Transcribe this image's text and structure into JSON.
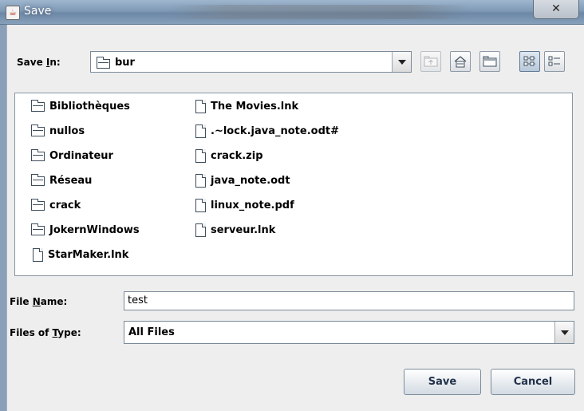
{
  "window": {
    "title": "Save",
    "close_label": "✕"
  },
  "save_in": {
    "label_pre": "Save ",
    "label_mnemonic": "I",
    "label_post": "n:",
    "value": "bur"
  },
  "toolbar": {
    "buttons": [
      "up-one-level",
      "home",
      "new-folder",
      "list-view",
      "details-view"
    ]
  },
  "files": {
    "left_column": [
      {
        "name": "Bibliothèques",
        "type": "folder"
      },
      {
        "name": "nullos",
        "type": "folder"
      },
      {
        "name": "Ordinateur",
        "type": "folder"
      },
      {
        "name": "Réseau",
        "type": "folder"
      },
      {
        "name": "crack",
        "type": "folder"
      },
      {
        "name": "JokernWindows",
        "type": "folder"
      },
      {
        "name": "StarMaker.lnk",
        "type": "file"
      }
    ],
    "right_column": [
      {
        "name": "The Movies.lnk",
        "type": "file"
      },
      {
        "name": ".~lock.java_note.odt#",
        "type": "file"
      },
      {
        "name": "crack.zip",
        "type": "file"
      },
      {
        "name": "java_note.odt",
        "type": "file"
      },
      {
        "name": "linux_note.pdf",
        "type": "file"
      },
      {
        "name": "serveur.lnk",
        "type": "file"
      }
    ]
  },
  "file_name": {
    "label_pre": "File ",
    "label_mnemonic": "N",
    "label_post": "ame:",
    "value": "test"
  },
  "file_type": {
    "label_pre": "Files of ",
    "label_mnemonic": "T",
    "label_post": "ype:",
    "value": "All Files"
  },
  "buttons": {
    "save": "Save",
    "cancel": "Cancel"
  },
  "colors": {
    "titlebar": "#7f9ab6",
    "dialog_bg": "#eeeeee",
    "button_text": "#22324a"
  }
}
